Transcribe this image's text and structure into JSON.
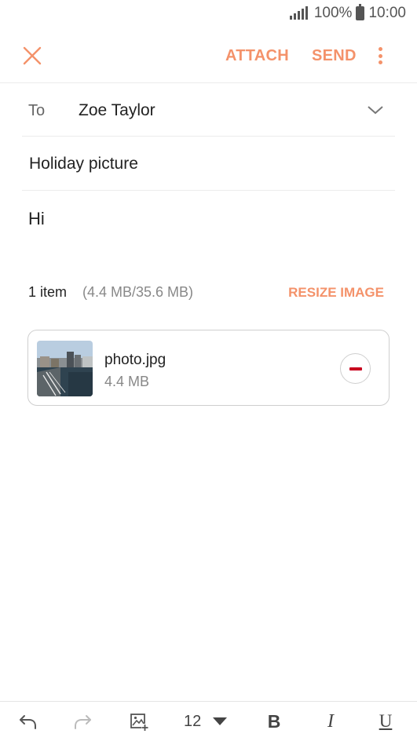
{
  "status_bar": {
    "battery_percent": "100%",
    "time": "10:00",
    "signal_icon": "signal-icon",
    "battery_icon": "battery-icon"
  },
  "toolbar": {
    "close_icon": "close-icon",
    "attach_label": "ATTACH",
    "send_label": "SEND",
    "more_icon": "more-vertical-icon",
    "accent_color": "#f4926a"
  },
  "compose": {
    "to_label": "To",
    "to_value": "Zoe Taylor",
    "subject": "Holiday picture",
    "body": "Hi"
  },
  "attachments": {
    "summary": "1 item",
    "size_info": "(4.4 MB/35.6 MB)",
    "resize_label": "RESIZE IMAGE",
    "items": [
      {
        "name": "photo.jpg",
        "size": "4.4 MB",
        "remove_icon": "remove-icon"
      }
    ]
  },
  "bottom_toolbar": {
    "undo_icon": "undo-icon",
    "redo_icon": "redo-icon",
    "insert_image_icon": "insert-image-icon",
    "font_size": "12",
    "font_size_dropdown_icon": "triangle-down-icon",
    "bold_label": "B",
    "italic_label": "I",
    "underline_label": "U"
  }
}
